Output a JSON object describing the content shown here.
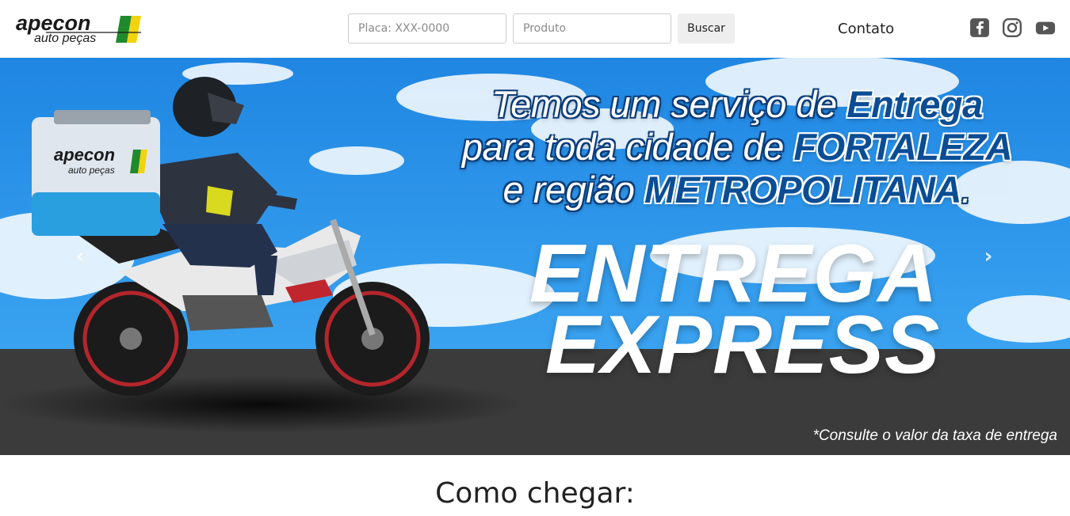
{
  "header": {
    "logo": {
      "line1": "apecon",
      "line2": "auto peças"
    },
    "search": {
      "plate_placeholder": "Placa: XXX-0000",
      "product_placeholder": "Produto",
      "button_label": "Buscar"
    },
    "contact_label": "Contato",
    "social": [
      "facebook-icon",
      "instagram-icon",
      "youtube-icon"
    ]
  },
  "banner": {
    "headline": {
      "line1_a": "Temos um serviço de ",
      "line1_b": "Entrega",
      "line2_a": "para toda cidade de ",
      "line2_b": "FORTALEZA",
      "line3_a": "e região ",
      "line3_b": "METROPOLITANA",
      "line3_c": "."
    },
    "express_line1": "ENTREGA",
    "express_line2": "EXPRESS",
    "disclaimer": "*Consulte o valor da taxa de entrega",
    "prev_arrow": "‹",
    "next_arrow": "›",
    "box_logo_line1": "apecon",
    "box_logo_line2": "auto peças"
  },
  "section": {
    "title": "Como chegar:"
  },
  "colors": {
    "sky": "#2a90e8",
    "road": "#3b3b3b",
    "brand_green": "#1f8a2c",
    "brand_yellow": "#f2d30f",
    "headline_blue": "#0b4d94"
  }
}
